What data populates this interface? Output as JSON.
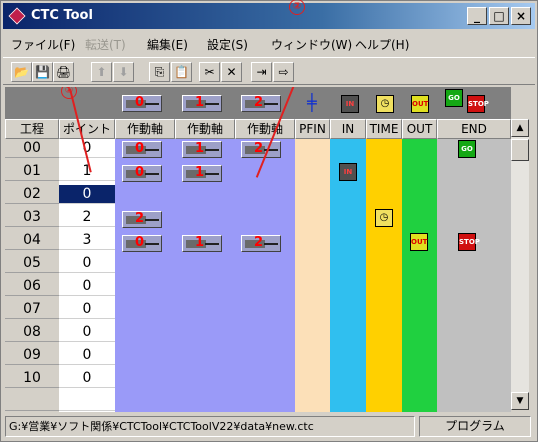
{
  "window": {
    "title": "CTC Tool",
    "min_label": "_",
    "max_label": "□",
    "close_label": "×"
  },
  "menu": [
    {
      "label": "ファイル(F)",
      "enabled": true
    },
    {
      "label": "転送(T)",
      "enabled": false
    },
    {
      "label": "編集(E)",
      "enabled": true
    },
    {
      "label": "設定(S)",
      "enabled": true
    },
    {
      "label": "ウィンドウ(W)",
      "enabled": true
    },
    {
      "label": "ヘルプ(H)",
      "enabled": true
    }
  ],
  "toolbar": {
    "icons": [
      "open-icon",
      "save-icon",
      "print-icon",
      "move-up-icon",
      "move-down-icon",
      "copy-icon",
      "paste-icon",
      "cut-icon",
      "delete-icon",
      "insert-row-icon",
      "append-row-icon"
    ],
    "glyphs": [
      "📂",
      "💾",
      "🖨",
      "⬆",
      "⬇",
      "⎘",
      "📋",
      "✂",
      "✕",
      "⇥",
      "⇨"
    ]
  },
  "palette": {
    "axis_numbers": [
      "0",
      "1",
      "2"
    ],
    "signals": {
      "go": "GO",
      "stop": "STOP",
      "out": "OUT",
      "in": "IN"
    }
  },
  "headers": [
    "工程",
    "ポイント",
    "作動軸",
    "作動軸",
    "作動軸",
    "PFIN",
    "IN",
    "TIME",
    "OUT",
    "END"
  ],
  "rows": [
    {
      "step": "00",
      "point": "0"
    },
    {
      "step": "01",
      "point": "1"
    },
    {
      "step": "02",
      "point": "0"
    },
    {
      "step": "03",
      "point": "2"
    },
    {
      "step": "04",
      "point": "3"
    },
    {
      "step": "05",
      "point": "0"
    },
    {
      "step": "06",
      "point": "0"
    },
    {
      "step": "07",
      "point": "0"
    },
    {
      "step": "08",
      "point": "0"
    },
    {
      "step": "09",
      "point": "0"
    },
    {
      "step": "10",
      "point": "0"
    },
    {
      "step": "",
      "point": ""
    }
  ],
  "markers": {
    "one": "①",
    "two": "②"
  },
  "status": {
    "path": "G:¥営業¥ソフト関係¥CTCTool¥CTCToolV22¥data¥new.ctc",
    "mode": "プログラム"
  },
  "colors": {
    "axis_column": "#9a9af8",
    "pfin_column": "#fce0b8",
    "in_column": "#30bfef",
    "time_column": "#ffd000",
    "out_column": "#20d040",
    "end_column": "#c0c0c0",
    "selected": "#0a246a"
  }
}
